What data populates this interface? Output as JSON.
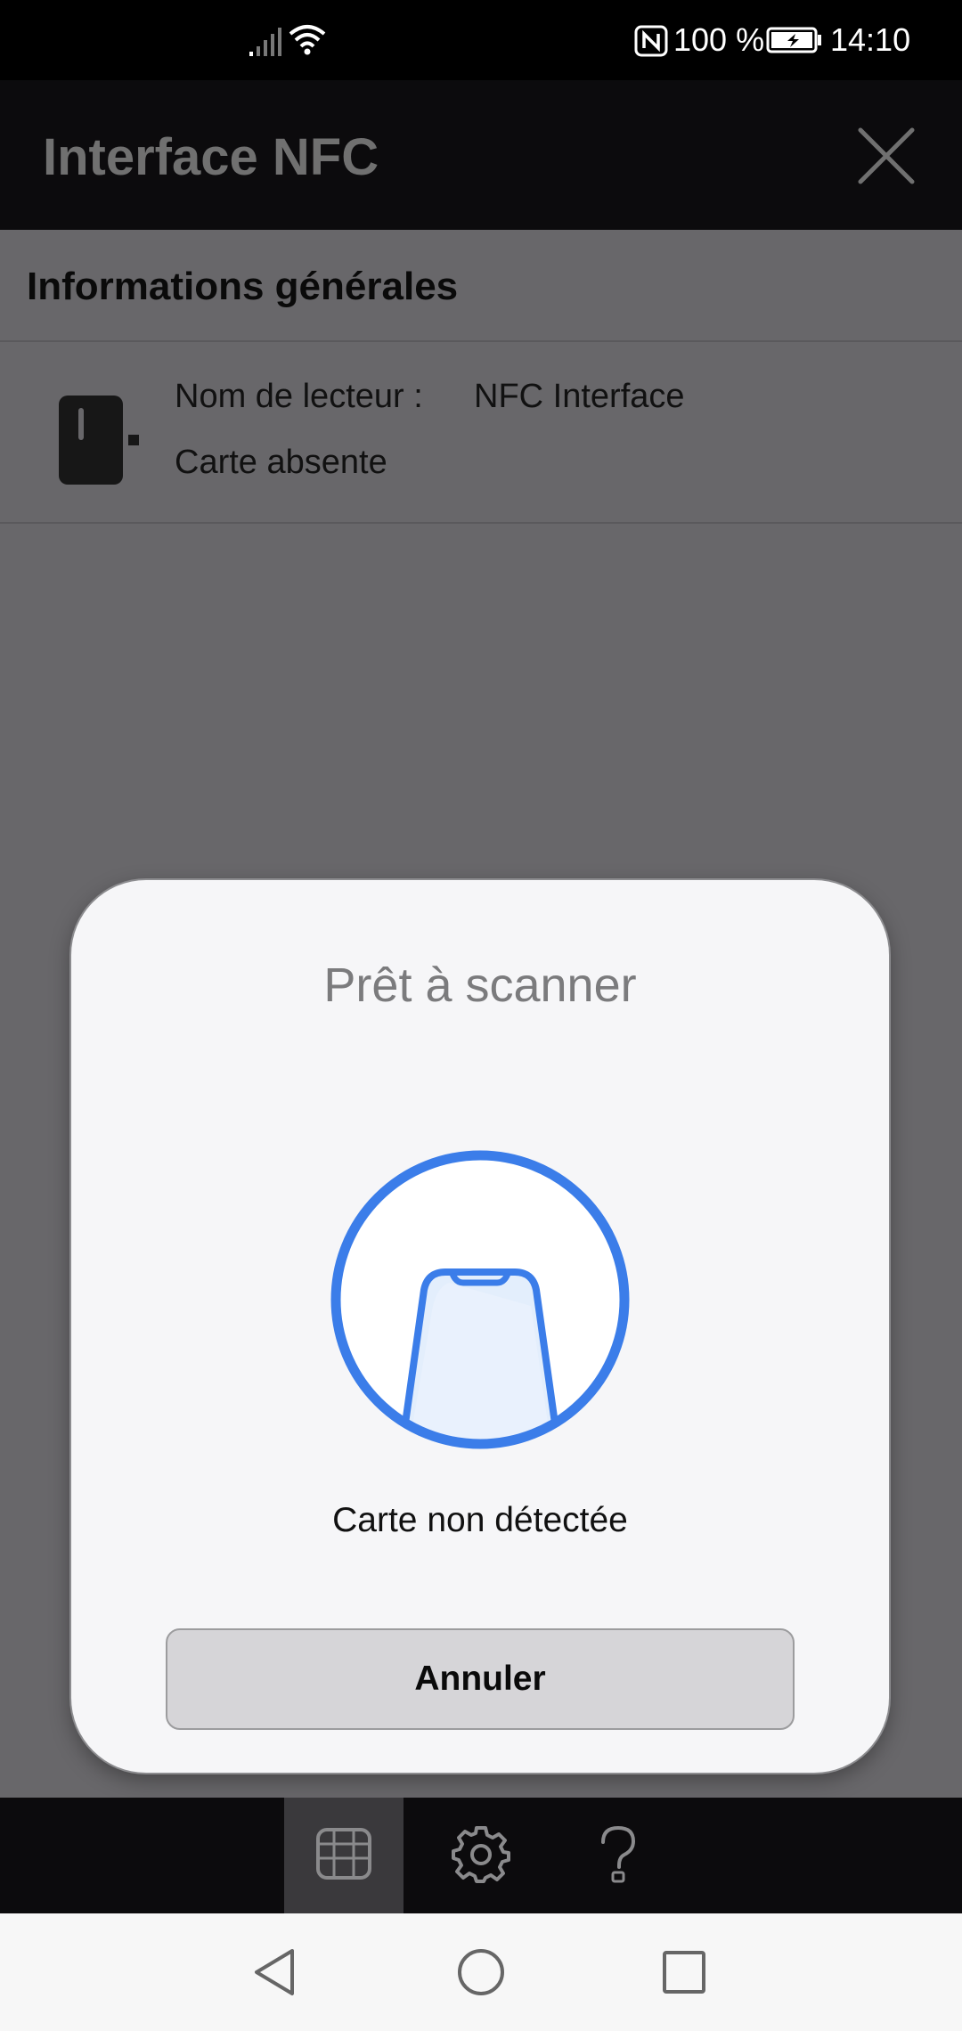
{
  "status_bar": {
    "battery_percent": "100 %",
    "time": "14:10",
    "icons": [
      "signal-icon",
      "wifi-icon",
      "nfc-icon",
      "battery-charging-icon"
    ]
  },
  "app_bar": {
    "title": "Interface NFC",
    "close_icon": "close-icon"
  },
  "section": {
    "title": "Informations générales"
  },
  "reader": {
    "label": "Nom de lecteur :",
    "value": "NFC Interface",
    "card_status": "Carte absente",
    "icon": "card-reader-icon"
  },
  "scan_sheet": {
    "title": "Prêt à scanner",
    "message": "Carte non détectée",
    "cancel_label": "Annuler",
    "icon": "phone-scan-icon",
    "accent_color": "#3b7de9"
  },
  "tab_bar": {
    "tabs": [
      {
        "icon": "card-list-icon",
        "active": true
      },
      {
        "icon": "gear-icon",
        "active": false
      },
      {
        "icon": "help-icon",
        "active": false
      }
    ]
  },
  "nav_bar": {
    "buttons": [
      "back-icon",
      "home-icon",
      "recents-icon"
    ]
  },
  "colors": {
    "overlay_background": "#68676a",
    "app_bar_background": "#0c0b0d",
    "sheet_background": "#f6f6f8",
    "button_background": "#d6d5d8"
  }
}
